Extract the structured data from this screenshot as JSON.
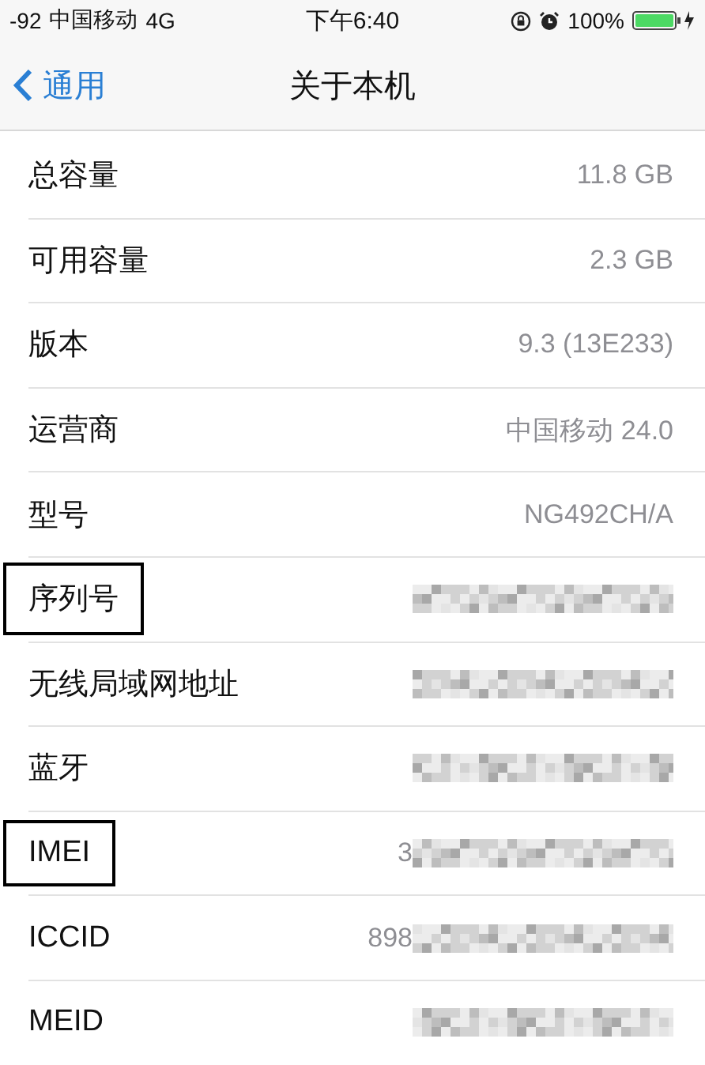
{
  "status_bar": {
    "signal": "-92",
    "carrier": "中国移动",
    "network": "4G",
    "time": "下午6:40",
    "battery": "100%"
  },
  "nav": {
    "back": "通用",
    "title": "关于本机"
  },
  "rows": [
    {
      "label": "总容量",
      "value": "11.8 GB",
      "redacted": false,
      "highlighted": false
    },
    {
      "label": "可用容量",
      "value": "2.3 GB",
      "redacted": false,
      "highlighted": false
    },
    {
      "label": "版本",
      "value": "9.3 (13E233)",
      "redacted": false,
      "highlighted": false
    },
    {
      "label": "运营商",
      "value": "中国移动 24.0",
      "redacted": false,
      "highlighted": false
    },
    {
      "label": "型号",
      "value": "NG492CH/A",
      "redacted": false,
      "highlighted": false
    },
    {
      "label": "序列号",
      "redacted": true,
      "highlighted": true
    },
    {
      "label": "无线局域网地址",
      "redacted": true,
      "highlighted": false
    },
    {
      "label": "蓝牙",
      "redacted": true,
      "highlighted": false
    },
    {
      "label": "IMEI",
      "value": "3",
      "redacted": true,
      "highlighted": true
    },
    {
      "label": "ICCID",
      "value": "898",
      "redacted": true,
      "highlighted": false
    },
    {
      "label": "MEID",
      "redacted": true,
      "highlighted": false
    }
  ]
}
